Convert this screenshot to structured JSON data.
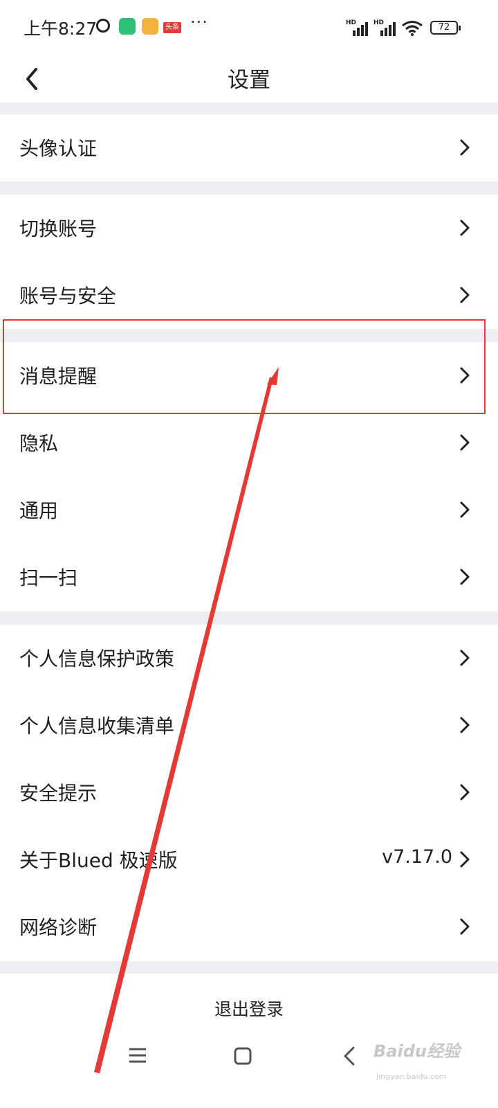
{
  "status_bar": {
    "time": "上午8:27",
    "news_app_label": "头条",
    "more_dots": "···",
    "signal_1_label": "HD",
    "signal_2_label": "HD",
    "battery": "72"
  },
  "header": {
    "title": "设置",
    "back_icon": "chevron-left-icon"
  },
  "settings": {
    "groups": [
      {
        "items": [
          {
            "label": "头像认证"
          }
        ]
      },
      {
        "items": [
          {
            "label": "切换账号"
          },
          {
            "label": "账号与安全"
          }
        ]
      },
      {
        "items": [
          {
            "label": "消息提醒"
          },
          {
            "label": "隐私"
          },
          {
            "label": "通用"
          },
          {
            "label": "扫一扫"
          }
        ]
      },
      {
        "items": [
          {
            "label": "个人信息保护政策"
          },
          {
            "label": "个人信息收集清单"
          },
          {
            "label": "安全提示"
          },
          {
            "label": "关于Blued 极速版",
            "value": "v7.17.0"
          },
          {
            "label": "网络诊断"
          }
        ]
      }
    ]
  },
  "logout": {
    "label": "退出登录"
  },
  "watermark": {
    "text": "Baidu经验",
    "sub": "jingyan.baidu.com"
  },
  "colors": {
    "highlight": "#e53935",
    "gap": "#eceef1",
    "accent_green": "#2fc07a",
    "accent_orange": "#f4b23e"
  }
}
